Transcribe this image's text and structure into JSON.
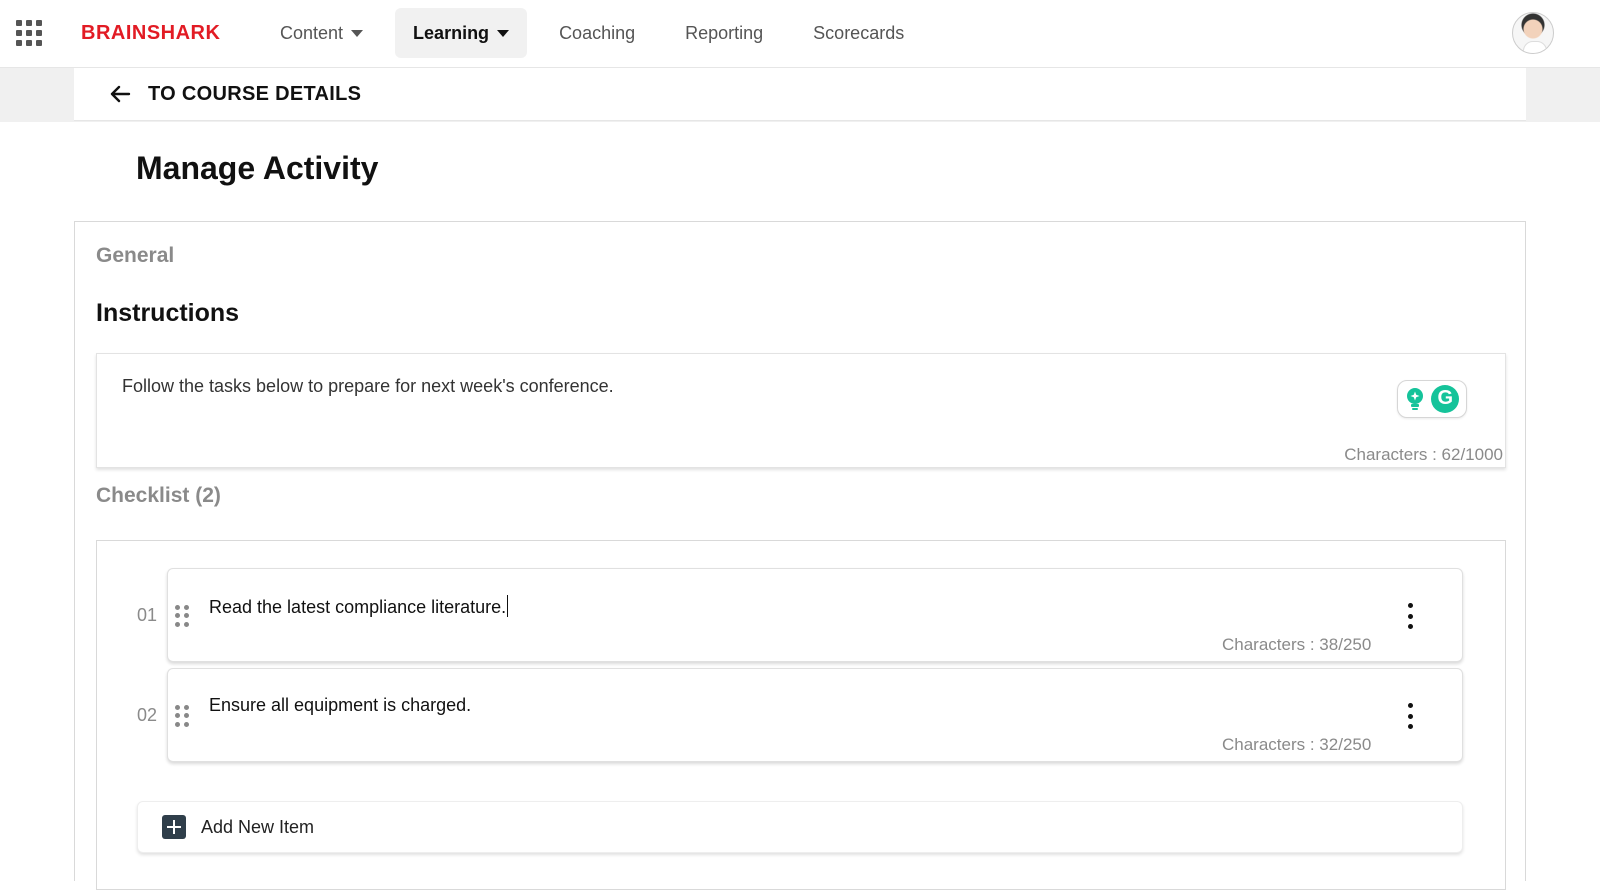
{
  "app": {
    "brand": "BRAINSHARK"
  },
  "nav": {
    "items": [
      {
        "label": "Content",
        "has_dropdown": true,
        "active": false
      },
      {
        "label": "Learning",
        "has_dropdown": true,
        "active": true
      },
      {
        "label": "Coaching",
        "has_dropdown": false,
        "active": false
      },
      {
        "label": "Reporting",
        "has_dropdown": false,
        "active": false
      },
      {
        "label": "Scorecards",
        "has_dropdown": false,
        "active": false
      }
    ]
  },
  "back": {
    "label": "TO COURSE DETAILS",
    "icon": "arrow-left-icon"
  },
  "page": {
    "title": "Manage Activity"
  },
  "sections": {
    "general": "General",
    "instructions": "Instructions",
    "checklist": "Checklist (2)"
  },
  "instructions": {
    "text": "Follow the tasks below to prepare for next week's conference.",
    "count": "Characters : 62/1000"
  },
  "checklist": {
    "items": [
      {
        "number": "01",
        "text": "Read the latest compliance literature.",
        "count": "Characters : 38/250",
        "focused": true
      },
      {
        "number": "02",
        "text": "Ensure all equipment is charged.",
        "count": "Characters : 32/250",
        "focused": false
      }
    ],
    "add_label": "Add New Item"
  },
  "colors": {
    "brand": "#e21b24",
    "grammarly": "#15c39a",
    "muted_text": "#8a8a8a",
    "active_nav_bg": "#f1f1f1"
  }
}
